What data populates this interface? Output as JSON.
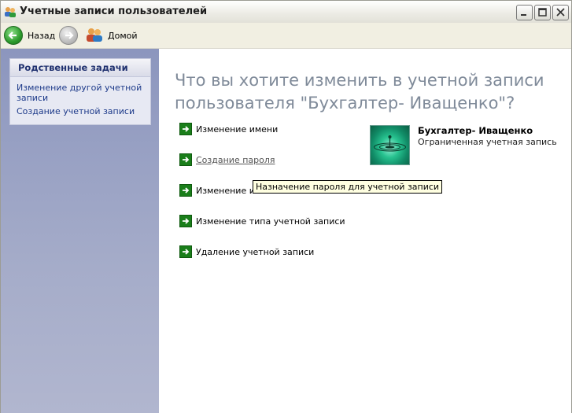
{
  "window": {
    "title": "Учетные записи пользователей"
  },
  "toolbar": {
    "back_label": "Назад",
    "home_label": "Домой"
  },
  "sidebar": {
    "panel_title": "Родственные задачи",
    "links": [
      {
        "label": "Изменение другой учетной записи"
      },
      {
        "label": "Создание учетной записи"
      }
    ]
  },
  "main": {
    "question": "Что вы хотите изменить в учетной записи пользователя \"Бухгалтер- Иващенко\"?",
    "tasks": [
      {
        "label": "Изменение имени"
      },
      {
        "label": "Создание пароля"
      },
      {
        "label": "Изменение изо"
      },
      {
        "label": "Изменение типа учетной записи"
      },
      {
        "label": "Удаление учетной записи"
      }
    ],
    "user": {
      "name": "Бухгалтер- Иващенко",
      "type": "Ограниченная учетная запись"
    },
    "tooltip": "Назначение пароля для учетной записи"
  },
  "colors": {
    "accent_green": "#1a7e1a",
    "sidebar_blue": "#8c96be",
    "question_gray": "#7f8a99"
  }
}
